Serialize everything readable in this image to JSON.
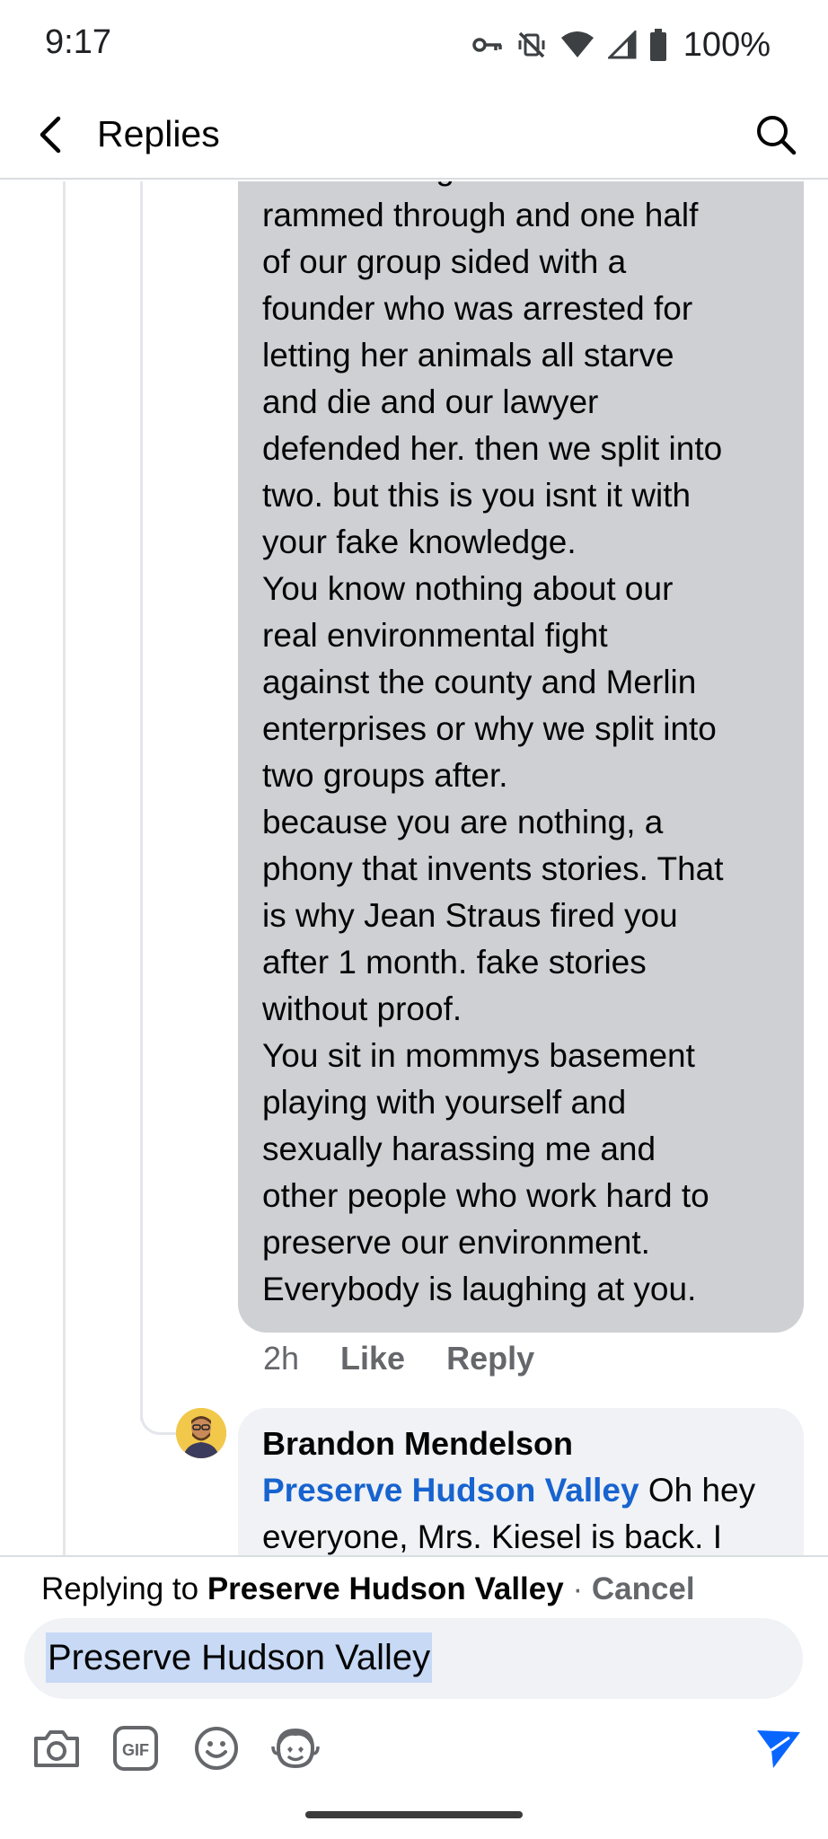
{
  "status_bar": {
    "time": "9:17",
    "battery": "100%",
    "icons": [
      "vpn-key-icon",
      "vibrate-off-icon",
      "wifi-icon",
      "signal-icon",
      "battery-icon"
    ]
  },
  "header": {
    "title": "Replies"
  },
  "main_comment": {
    "text": "two after Legoland was\nrammed through and one half\nof our group sided with a\nfounder who was arrested for\nletting her animals all starve\nand die and our lawyer\ndefended her. then we split into\ntwo. but this is you isnt it with\nyour fake knowledge.\nYou know nothing about our\nreal environmental fight\nagainst the county and Merlin\nenterprises or why we split into\ntwo groups after.\nbecause you are nothing, a\nphony that invents stories. That\nis why Jean Straus fired you\nafter 1 month. fake stories\nwithout proof.\nYou sit in mommys basement\nplaying with yourself and\nsexually harassing me and\nother people who work hard to\npreserve our environment.\nEverybody is laughing at you.",
    "time": "2h",
    "like_label": "Like",
    "reply_label": "Reply"
  },
  "reply_comment": {
    "author": "Brandon Mendelson",
    "mention": "Preserve Hudson Valley",
    "text_line1": " Oh hey",
    "text_line2": "everyone, Mrs. Kiesel is back. I"
  },
  "composer": {
    "replying_prefix": "Replying to ",
    "replying_target": "Preserve Hudson Valley",
    "separator": " · ",
    "cancel_label": "Cancel",
    "input_value": "Preserve Hudson Valley",
    "tools": [
      "camera-icon",
      "gif-icon",
      "emoji-icon",
      "avatar-sticker-icon",
      "send-icon"
    ]
  },
  "colors": {
    "bubble_main": "#ced0d4",
    "bubble_reply": "#f0f2f5",
    "mention": "#1763cf",
    "send": "#0866ff",
    "muted": "#65676b"
  }
}
